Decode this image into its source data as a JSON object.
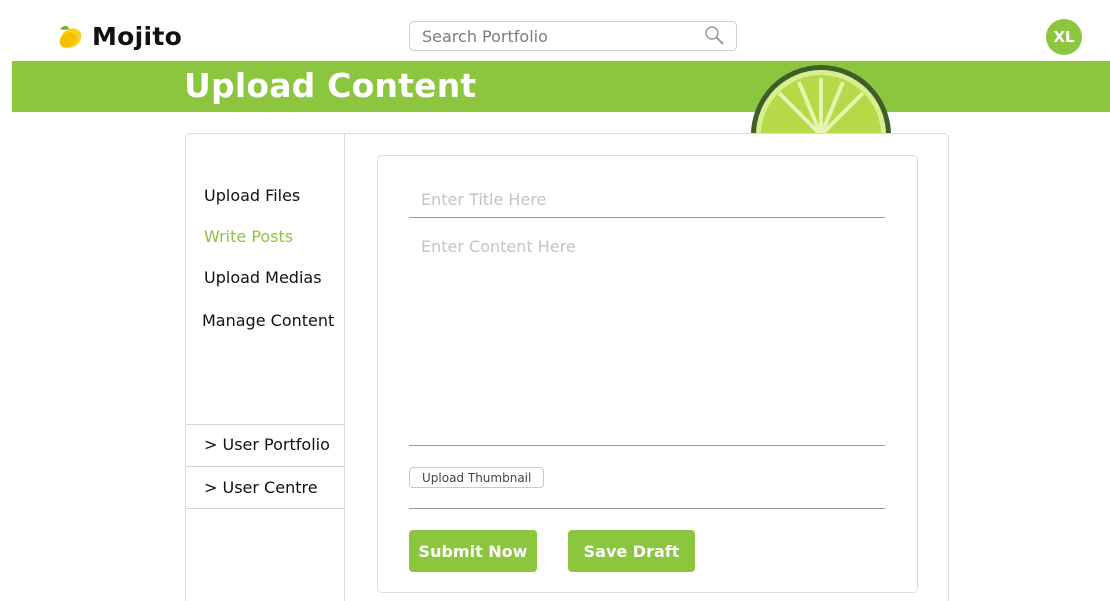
{
  "brand": {
    "name": "Mojito",
    "icon": "lemon-icon"
  },
  "search": {
    "placeholder": "Search Portfolio",
    "icon": "search-icon"
  },
  "user": {
    "initials": "XL"
  },
  "page": {
    "title": "Upload Content"
  },
  "sidebar": {
    "items": [
      {
        "label": "Upload Files",
        "active": false
      },
      {
        "label": "Write Posts",
        "active": true
      },
      {
        "label": "Upload Medias",
        "active": false
      },
      {
        "label": "Manage Content",
        "active": false
      }
    ],
    "links": [
      {
        "label": "> User Portfolio"
      },
      {
        "label": "> User Centre"
      }
    ]
  },
  "editor": {
    "title_placeholder": "Enter Title Here",
    "content_placeholder": "Enter Content Here",
    "thumbnail_label": "Upload Thumbnail",
    "submit_label": "Submit Now",
    "draft_label": "Save Draft"
  },
  "colors": {
    "accent": "#8cc63f",
    "text": "#111111",
    "placeholder": "#c4c4c4"
  }
}
